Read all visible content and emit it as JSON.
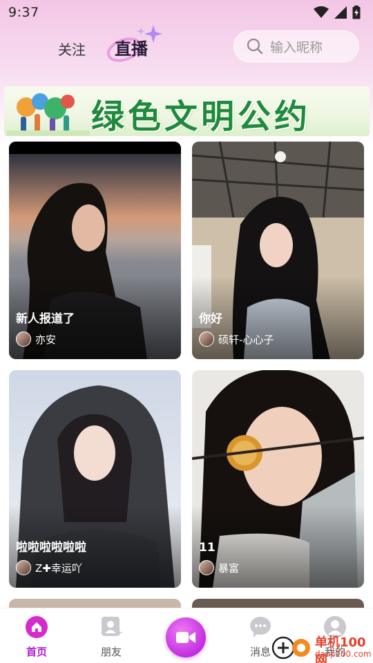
{
  "status": {
    "time": "9:37"
  },
  "tabs": {
    "follow": "关注",
    "live": "直播"
  },
  "search": {
    "placeholder": "输入昵称"
  },
  "banner": {
    "text": "绿色文明公约"
  },
  "cards": [
    {
      "title": "新人报道了",
      "user": "亦安"
    },
    {
      "title": "你好",
      "user": "硕轩-心心子"
    },
    {
      "title": "啦啦啦啦啦啦",
      "user": "Z✚幸运吖"
    },
    {
      "title": "11",
      "user": "暴富"
    }
  ],
  "nav": {
    "home": "首页",
    "friends": "朋友",
    "messages": "消息",
    "mine": "我的"
  },
  "watermark": {
    "line1": "单机100网",
    "line2": "danji100.com"
  },
  "colors": {
    "accent": "#b01cd9",
    "banner_green": "#1f8a3c",
    "header_pink": "#f3c6e6"
  }
}
